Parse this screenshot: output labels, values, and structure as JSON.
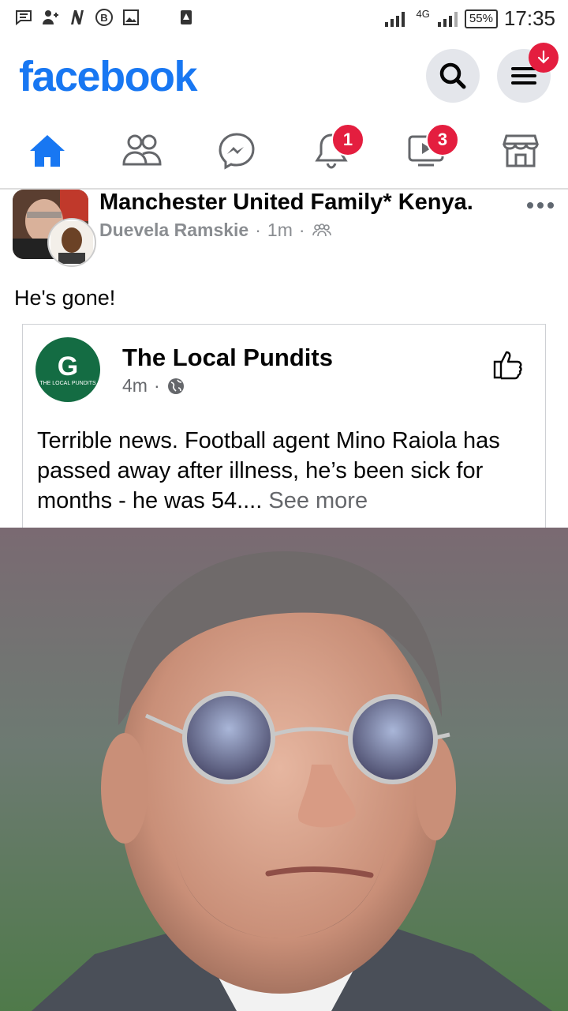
{
  "status_bar": {
    "left_icons": [
      "chat-icon",
      "add-user-icon",
      "n-icon",
      "b-icon",
      "image-icon",
      "warning-icon"
    ],
    "network": "4G",
    "battery": "55%",
    "time": "17:35"
  },
  "header": {
    "logo": "facebook",
    "search_icon": "search-icon",
    "menu_icon": "menu-icon"
  },
  "tabs": [
    {
      "name": "home",
      "icon": "home-icon",
      "badge": ""
    },
    {
      "name": "friends",
      "icon": "friends-icon",
      "badge": ""
    },
    {
      "name": "messenger",
      "icon": "messenger-icon",
      "badge": ""
    },
    {
      "name": "notifications",
      "icon": "bell-icon",
      "badge": "1"
    },
    {
      "name": "watch",
      "icon": "video-icon",
      "badge": "3"
    },
    {
      "name": "marketplace",
      "icon": "store-icon",
      "badge": ""
    }
  ],
  "post": {
    "group_name": "Manchester United Family* Kenya.",
    "author": "Duevela Ramskie",
    "time": "1m",
    "text": "He's gone!",
    "shared": {
      "page_name": "The Local Pundits",
      "avatar_text": "THE LOCAL PUNDITS",
      "time": "4m",
      "text": "Terrible news. Football agent Mino Raiola has passed away after illness, he’s been sick for months - he was 54....",
      "see_more": " See more"
    }
  },
  "colors": {
    "brand": "#1877f2",
    "badge": "#e41e3f"
  }
}
